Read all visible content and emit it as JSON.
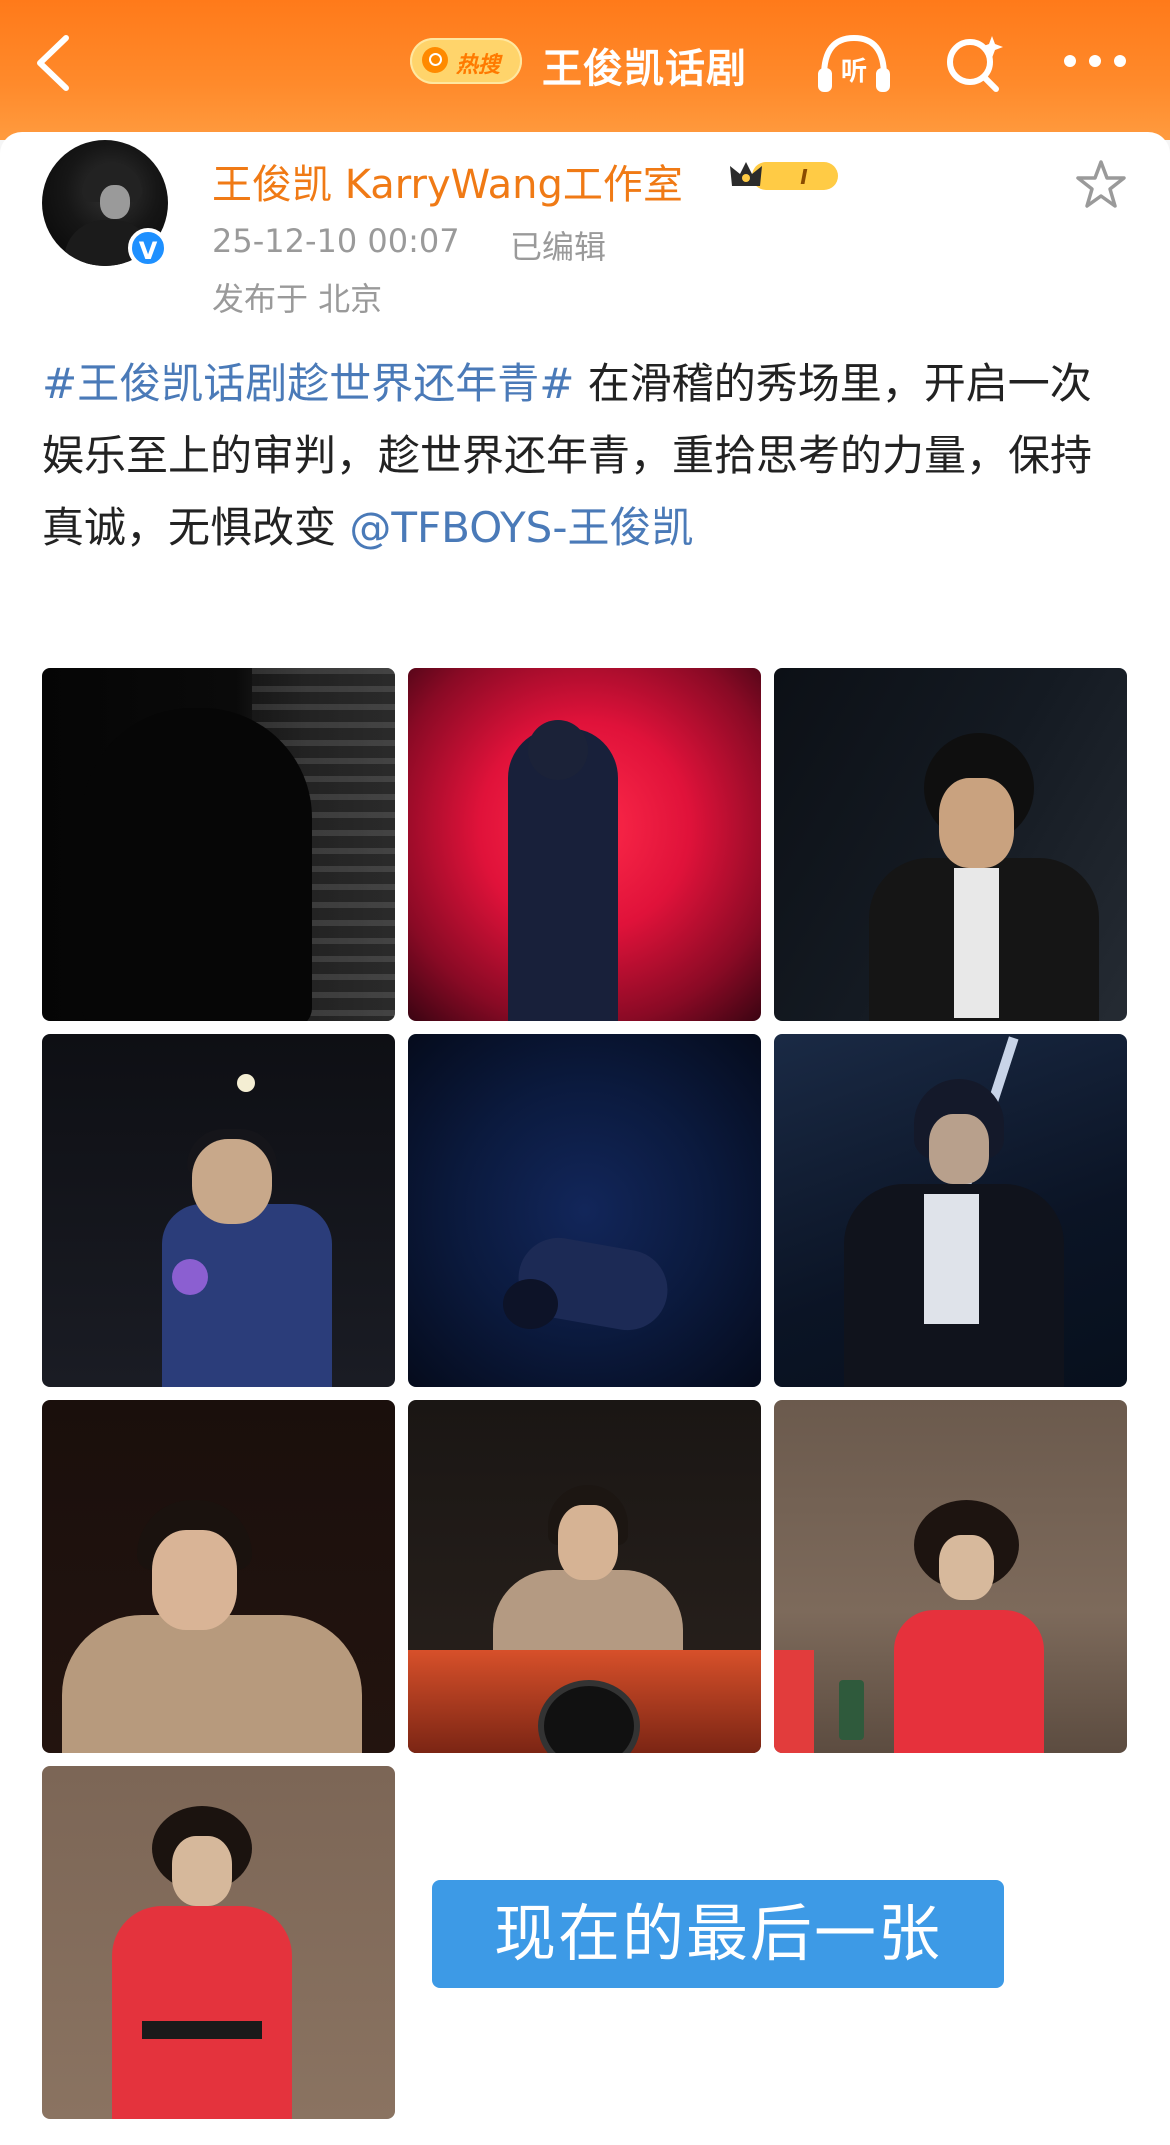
{
  "header": {
    "back_icon": "back-arrow-icon",
    "hot_badge_label": "热搜",
    "title": "王俊凯话剧",
    "listen_label": "听",
    "search_icon": "search-sparkle-icon",
    "more_icon": "more-dots-icon",
    "background_color": "#ff7a1a"
  },
  "post": {
    "author": {
      "name": "王俊凯 KarryWang工作室",
      "verified_icon": "verified-v-icon",
      "verified_label": "V",
      "membership_badge_label": "I",
      "name_color": "#f07a15"
    },
    "timestamp": "25-12-10 00:07",
    "edited_label": "已编辑",
    "location": "发布于 北京",
    "favorite_icon": "star-icon",
    "text": {
      "hashtag": "#王俊凯话剧趁世界还年青#",
      "body": " 在滑稽的秀场里，开启一次娱乐至上的审判，趁世界还年青，重拾思考的力量，保持真诚，无惧改变 ",
      "mention": "@TFBOYS-王俊凯",
      "link_color": "#4a7ab8"
    },
    "images": [
      {
        "name": "photo-1"
      },
      {
        "name": "photo-2"
      },
      {
        "name": "photo-3"
      },
      {
        "name": "photo-4"
      },
      {
        "name": "photo-5"
      },
      {
        "name": "photo-6"
      },
      {
        "name": "photo-7"
      },
      {
        "name": "photo-8"
      },
      {
        "name": "photo-9"
      },
      {
        "name": "photo-10"
      }
    ],
    "overlay_caption": "现在的最后一张",
    "overlay_color": "#3d9ae6"
  }
}
